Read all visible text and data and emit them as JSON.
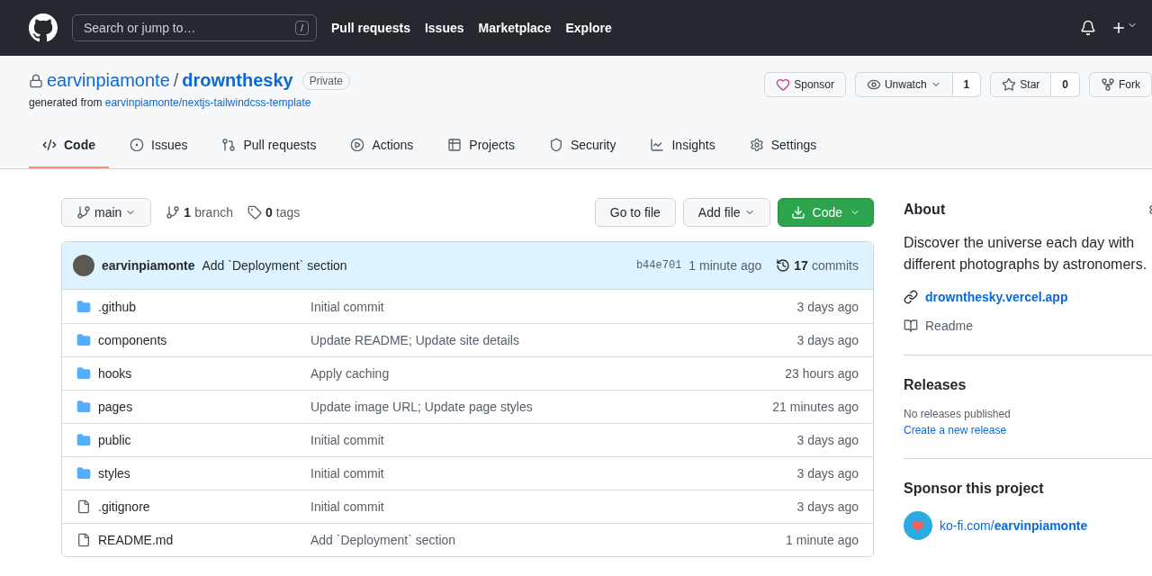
{
  "header": {
    "search_placeholder": "Search or jump to…",
    "search_key": "/",
    "nav": [
      "Pull requests",
      "Issues",
      "Marketplace",
      "Explore"
    ]
  },
  "repo": {
    "owner": "earvinpiamonte",
    "separator": "/",
    "name": "drownthesky",
    "visibility": "Private",
    "generated_prefix": "generated from",
    "generated_link": "earvinpiamonte/nextjs-tailwindcss-template",
    "actions": [
      {
        "kind": "sponsor",
        "label": "Sponsor"
      },
      {
        "kind": "watch",
        "label": "Unwatch",
        "count": "1"
      },
      {
        "kind": "star",
        "label": "Star",
        "count": "0"
      },
      {
        "kind": "fork",
        "label": "Fork"
      }
    ]
  },
  "tabs": [
    {
      "label": "Code",
      "selected": true
    },
    {
      "label": "Issues",
      "selected": false
    },
    {
      "label": "Pull requests",
      "selected": false
    },
    {
      "label": "Actions",
      "selected": false
    },
    {
      "label": "Projects",
      "selected": false
    },
    {
      "label": "Security",
      "selected": false
    },
    {
      "label": "Insights",
      "selected": false
    },
    {
      "label": "Settings",
      "selected": false
    }
  ],
  "toolbar": {
    "branch": "main",
    "branches_count": "1",
    "branches_label": "branch",
    "tags_count": "0",
    "tags_label": "tags",
    "goto": "Go to file",
    "add": "Add file",
    "code": "Code"
  },
  "commit": {
    "author": "earvinpiamonte",
    "message": "Add `Deployment` section",
    "sha": "b44e701",
    "time": "1 minute ago",
    "count": "17",
    "count_label": "commits"
  },
  "files": [
    {
      "kind": "dir",
      "name": ".github",
      "message": "Initial commit",
      "age": "3 days ago"
    },
    {
      "kind": "dir",
      "name": "components",
      "message": "Update README; Update site details",
      "age": "3 days ago"
    },
    {
      "kind": "dir",
      "name": "hooks",
      "message": "Apply caching",
      "age": "23 hours ago"
    },
    {
      "kind": "dir",
      "name": "pages",
      "message": "Update image URL; Update page styles",
      "age": "21 minutes ago"
    },
    {
      "kind": "dir",
      "name": "public",
      "message": "Initial commit",
      "age": "3 days ago"
    },
    {
      "kind": "dir",
      "name": "styles",
      "message": "Initial commit",
      "age": "3 days ago"
    },
    {
      "kind": "file",
      "name": ".gitignore",
      "message": "Initial commit",
      "age": "3 days ago"
    },
    {
      "kind": "file",
      "name": "README.md",
      "message": "Add `Deployment` section",
      "age": "1 minute ago"
    }
  ],
  "about": {
    "title": "About",
    "description": "Discover the universe each day with different photographs by astronomers.",
    "website": "drownthesky.vercel.app",
    "readme": "Readme"
  },
  "releases": {
    "title": "Releases",
    "empty": "No releases published",
    "create": "Create a new release"
  },
  "sponsor": {
    "title": "Sponsor this project",
    "link_prefix": "ko-fi.com/",
    "link_user": "earvinpiamonte"
  }
}
